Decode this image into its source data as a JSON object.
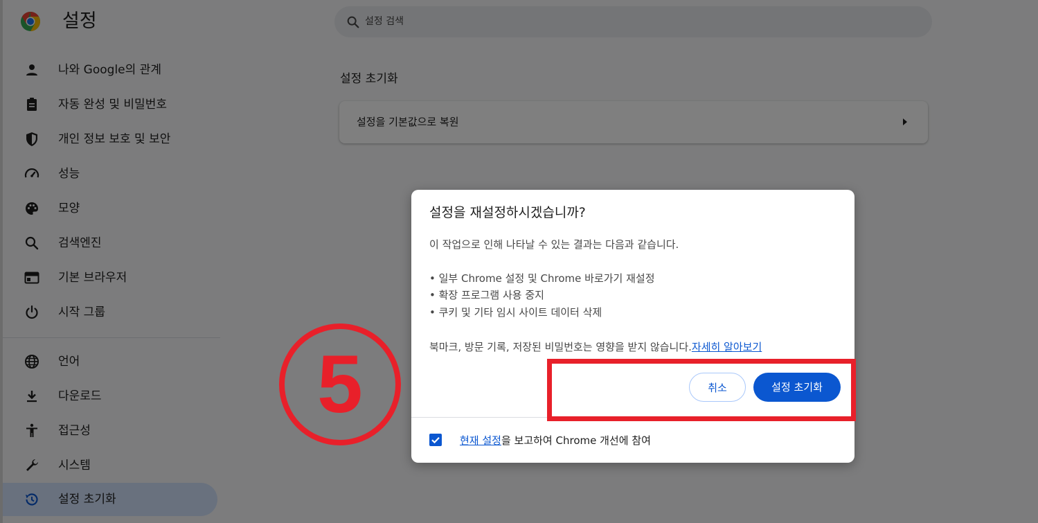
{
  "header": {
    "title": "설정",
    "search_placeholder": "설정 검색"
  },
  "sidebar": {
    "items": [
      {
        "label": "나와 Google의 관계",
        "icon": "person-icon"
      },
      {
        "label": "자동 완성 및 비밀번호",
        "icon": "clipboard-icon"
      },
      {
        "label": "개인 정보 보호 및 보안",
        "icon": "shield-icon"
      },
      {
        "label": "성능",
        "icon": "speedometer-icon"
      },
      {
        "label": "모양",
        "icon": "palette-icon"
      },
      {
        "label": "검색엔진",
        "icon": "search-icon"
      },
      {
        "label": "기본 브라우저",
        "icon": "browser-icon"
      },
      {
        "label": "시작 그룹",
        "icon": "power-icon"
      },
      {
        "label": "언어",
        "icon": "globe-icon"
      },
      {
        "label": "다운로드",
        "icon": "download-icon"
      },
      {
        "label": "접근성",
        "icon": "accessibility-icon"
      },
      {
        "label": "시스템",
        "icon": "wrench-icon"
      },
      {
        "label": "설정 초기화",
        "icon": "history-icon",
        "active": true
      }
    ]
  },
  "main": {
    "section_title": "설정 초기화",
    "card_label": "설정을 기본값으로 복원"
  },
  "dialog": {
    "title": "설정을 재설정하시겠습니까?",
    "intro": "이 작업으로 인해 나타날 수 있는 결과는 다음과 같습니다.",
    "bullets": [
      "• 일부 Chrome 설정 및 Chrome 바로가기 재설정",
      "• 확장 프로그램 사용 중지",
      "• 쿠키 및 기타 임시 사이트 데이터 삭제"
    ],
    "note": "북마크, 방문 기록, 저장된 비밀번호는 영향을 받지 않습니다.",
    "learn_more": "자세히 알아보기",
    "cancel_label": "취소",
    "reset_label": "설정 초기화",
    "report_link": "현재 설정",
    "report_text": "을 보고하여 Chrome 개선에 참여",
    "report_checked": true
  },
  "annotation": {
    "step_number": "5",
    "color": "#e8202a"
  },
  "colors": {
    "accent": "#0b57d0",
    "active_nav": "#d3e3fd"
  }
}
